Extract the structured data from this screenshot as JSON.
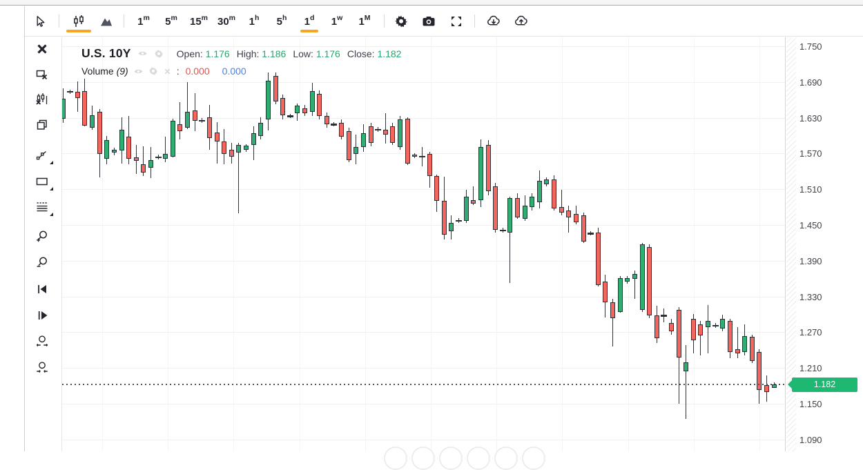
{
  "colors": {
    "accent_orange": "#f5a623",
    "up_green": "#2fae73",
    "down_red": "#f4655d",
    "wick_dark": "#2b2f36",
    "value_green": "#28a56e",
    "volume_red": "#df544e",
    "volume_blue": "#4a80e8",
    "badge_green": "#1fb873"
  },
  "toolbar": {
    "chart_tools": [
      {
        "icon": "cursor-icon",
        "selected": false
      },
      {
        "icon": "candlestick-icon",
        "selected": true
      },
      {
        "icon": "area-chart-icon",
        "selected": false
      }
    ],
    "intervals": [
      {
        "base": "1",
        "sup": "m",
        "selected": false
      },
      {
        "base": "5",
        "sup": "m",
        "selected": false
      },
      {
        "base": "15",
        "sup": "m",
        "selected": false
      },
      {
        "base": "30",
        "sup": "m",
        "selected": false
      },
      {
        "base": "1",
        "sup": "h",
        "selected": false
      },
      {
        "base": "5",
        "sup": "h",
        "selected": false
      },
      {
        "base": "1",
        "sup": "d",
        "selected": true
      },
      {
        "base": "1",
        "sup": "w",
        "selected": false
      },
      {
        "base": "1",
        "sup": "M",
        "selected": false
      }
    ],
    "actions": [
      {
        "icon": "settings-icon"
      },
      {
        "icon": "camera-icon"
      },
      {
        "icon": "fullscreen-icon"
      }
    ],
    "transfer": [
      {
        "icon": "download-icon"
      },
      {
        "icon": "upload-icon"
      }
    ]
  },
  "sidebar": {
    "tools": [
      {
        "icon": "close-icon",
        "dropdown": false
      },
      {
        "icon": "deselect-icon",
        "dropdown": false
      },
      {
        "icon": "remove-indicators-icon",
        "dropdown": false
      },
      {
        "icon": "clone-icon",
        "dropdown": false
      },
      {
        "icon": "trendline-icon",
        "dropdown": true
      },
      {
        "icon": "rectangle-icon",
        "dropdown": true
      },
      {
        "icon": "fib-lines-icon",
        "dropdown": true
      },
      {
        "icon": "zoom-in-icon",
        "dropdown": false
      },
      {
        "icon": "zoom-out-icon",
        "dropdown": false
      },
      {
        "icon": "scroll-left-icon",
        "dropdown": false
      },
      {
        "icon": "scroll-right-icon",
        "dropdown": false
      },
      {
        "icon": "zoom-range-icon",
        "dropdown": false
      },
      {
        "icon": "reset-zoom-icon",
        "dropdown": false
      }
    ]
  },
  "legend": {
    "symbol": "U.S. 10Y",
    "icons": [
      "eye-icon",
      "gear-sm-icon"
    ],
    "items": [
      {
        "label": "Open:",
        "value": "1.176"
      },
      {
        "label": "High:",
        "value": "1.186"
      },
      {
        "label": "Low:",
        "value": "1.176"
      },
      {
        "label": "Close:",
        "value": "1.182"
      }
    ]
  },
  "volume_row": {
    "label": "Volume",
    "param": "(9)",
    "icons": [
      "eye-icon",
      "gear-sm-icon",
      "x-sm-icon"
    ],
    "separator": ":",
    "values": [
      {
        "value": "0.000",
        "color": "volume_red"
      },
      {
        "value": "0.000",
        "color": "volume_blue"
      }
    ]
  },
  "y_axis": {
    "labels": [
      "1.750",
      "1.690",
      "1.630",
      "1.570",
      "1.510",
      "1.450",
      "1.390",
      "1.330",
      "1.270",
      "1.210",
      "1.150",
      "1.090"
    ]
  },
  "price_badge": {
    "value": "1.182"
  },
  "pager": {
    "dots": 6
  },
  "chart_data": {
    "type": "candlestick",
    "title": "U.S. 10Y",
    "interval": "1d",
    "ylim": [
      1.07,
      1.765
    ],
    "y_ticks": [
      1.75,
      1.69,
      1.63,
      1.57,
      1.51,
      1.45,
      1.39,
      1.33,
      1.27,
      1.21,
      1.15,
      1.09
    ],
    "current_price": 1.182,
    "grid": true,
    "legend_position": "top-left",
    "ohlc_format": [
      "open",
      "high",
      "low",
      "close",
      "kind(g=up,r=down,d=doji)"
    ],
    "candles": [
      [
        1.628,
        1.679,
        1.621,
        1.662,
        "g"
      ],
      [
        1.674,
        1.677,
        1.67,
        1.674,
        "d"
      ],
      [
        1.674,
        1.691,
        1.64,
        1.663,
        "r"
      ],
      [
        1.675,
        1.695,
        1.615,
        1.617,
        "r"
      ],
      [
        1.613,
        1.65,
        1.61,
        1.634,
        "g"
      ],
      [
        1.64,
        1.645,
        1.53,
        1.569,
        "r"
      ],
      [
        1.561,
        1.599,
        1.552,
        1.592,
        "g"
      ],
      [
        1.571,
        1.58,
        1.567,
        1.576,
        "g"
      ],
      [
        1.575,
        1.631,
        1.553,
        1.61,
        "g"
      ],
      [
        1.598,
        1.633,
        1.552,
        1.561,
        "r"
      ],
      [
        1.564,
        1.584,
        1.536,
        1.558,
        "r"
      ],
      [
        1.552,
        1.582,
        1.532,
        1.538,
        "r"
      ],
      [
        1.546,
        1.581,
        1.529,
        1.559,
        "g"
      ],
      [
        1.564,
        1.568,
        1.56,
        1.564,
        "d"
      ],
      [
        1.561,
        1.598,
        1.555,
        1.569,
        "g"
      ],
      [
        1.565,
        1.628,
        1.563,
        1.625,
        "g"
      ],
      [
        1.619,
        1.656,
        1.594,
        1.608,
        "r"
      ],
      [
        1.613,
        1.69,
        1.611,
        1.64,
        "g"
      ],
      [
        1.642,
        1.671,
        1.608,
        1.625,
        "r"
      ],
      [
        1.625,
        1.629,
        1.621,
        1.625,
        "d"
      ],
      [
        1.631,
        1.652,
        1.576,
        1.596,
        "r"
      ],
      [
        1.605,
        1.623,
        1.553,
        1.59,
        "r"
      ],
      [
        1.59,
        1.611,
        1.552,
        1.569,
        "r"
      ],
      [
        1.576,
        1.588,
        1.553,
        1.565,
        "r"
      ],
      [
        1.571,
        1.588,
        1.469,
        1.584,
        "g"
      ],
      [
        1.576,
        1.586,
        1.573,
        1.583,
        "g"
      ],
      [
        1.584,
        1.616,
        1.559,
        1.604,
        "g"
      ],
      [
        1.599,
        1.631,
        1.593,
        1.621,
        "g"
      ],
      [
        1.627,
        1.706,
        1.608,
        1.692,
        "g"
      ],
      [
        1.7,
        1.706,
        1.652,
        1.657,
        "r"
      ],
      [
        1.663,
        1.669,
        1.627,
        1.634,
        "r"
      ],
      [
        1.633,
        1.637,
        1.629,
        1.633,
        "d"
      ],
      [
        1.637,
        1.654,
        1.625,
        1.65,
        "g"
      ],
      [
        1.646,
        1.652,
        1.633,
        1.638,
        "r"
      ],
      [
        1.64,
        1.689,
        1.633,
        1.675,
        "g"
      ],
      [
        1.67,
        1.676,
        1.627,
        1.633,
        "r"
      ],
      [
        1.633,
        1.639,
        1.613,
        1.619,
        "r"
      ],
      [
        1.619,
        1.623,
        1.615,
        1.619,
        "d"
      ],
      [
        1.621,
        1.627,
        1.593,
        1.598,
        "r"
      ],
      [
        1.608,
        1.613,
        1.555,
        1.559,
        "r"
      ],
      [
        1.569,
        1.602,
        1.552,
        1.581,
        "g"
      ],
      [
        1.581,
        1.619,
        1.573,
        1.604,
        "g"
      ],
      [
        1.616,
        1.622,
        1.582,
        1.588,
        "r"
      ],
      [
        1.61,
        1.614,
        1.606,
        1.61,
        "d"
      ],
      [
        1.61,
        1.638,
        1.587,
        1.602,
        "r"
      ],
      [
        1.616,
        1.622,
        1.584,
        1.588,
        "r"
      ],
      [
        1.581,
        1.633,
        1.576,
        1.627,
        "g"
      ],
      [
        1.628,
        1.631,
        1.551,
        1.553,
        "r"
      ],
      [
        1.565,
        1.571,
        1.562,
        1.568,
        "g"
      ],
      [
        1.565,
        1.581,
        1.548,
        1.565,
        "d"
      ],
      [
        1.569,
        1.573,
        1.513,
        1.532,
        "r"
      ],
      [
        1.532,
        1.534,
        1.472,
        1.49,
        "r"
      ],
      [
        1.49,
        1.531,
        1.426,
        1.434,
        "r"
      ],
      [
        1.44,
        1.466,
        1.425,
        1.454,
        "g"
      ],
      [
        1.457,
        1.461,
        1.453,
        1.457,
        "d"
      ],
      [
        1.457,
        1.509,
        1.454,
        1.498,
        "g"
      ],
      [
        1.492,
        1.515,
        1.483,
        1.486,
        "r"
      ],
      [
        1.492,
        1.594,
        1.48,
        1.581,
        "g"
      ],
      [
        1.584,
        1.593,
        1.5,
        1.507,
        "r"
      ],
      [
        1.515,
        1.521,
        1.437,
        1.442,
        "r"
      ],
      [
        1.441,
        1.445,
        1.437,
        1.441,
        "d"
      ],
      [
        1.437,
        1.498,
        1.353,
        1.495,
        "g"
      ],
      [
        1.495,
        1.503,
        1.46,
        1.463,
        "r"
      ],
      [
        1.461,
        1.5,
        1.457,
        1.483,
        "g"
      ],
      [
        1.48,
        1.503,
        1.474,
        1.498,
        "g"
      ],
      [
        1.488,
        1.542,
        1.478,
        1.524,
        "g"
      ],
      [
        1.518,
        1.53,
        1.515,
        1.527,
        "g"
      ],
      [
        1.527,
        1.533,
        1.474,
        1.478,
        "r"
      ],
      [
        1.48,
        1.509,
        1.466,
        1.471,
        "r"
      ],
      [
        1.474,
        1.483,
        1.437,
        1.463,
        "r"
      ],
      [
        1.469,
        1.483,
        1.451,
        1.455,
        "r"
      ],
      [
        1.466,
        1.471,
        1.42,
        1.422,
        "r"
      ],
      [
        1.436,
        1.44,
        1.432,
        1.436,
        "d"
      ],
      [
        1.437,
        1.445,
        1.347,
        1.349,
        "r"
      ],
      [
        1.355,
        1.367,
        1.295,
        1.32,
        "r"
      ],
      [
        1.32,
        1.326,
        1.246,
        1.293,
        "r"
      ],
      [
        1.304,
        1.364,
        1.303,
        1.361,
        "g"
      ],
      [
        1.355,
        1.364,
        1.352,
        1.361,
        "g"
      ],
      [
        1.359,
        1.374,
        1.326,
        1.368,
        "g"
      ],
      [
        1.307,
        1.42,
        1.304,
        1.417,
        "g"
      ],
      [
        1.413,
        1.417,
        1.293,
        1.298,
        "r"
      ],
      [
        1.298,
        1.315,
        1.252,
        1.26,
        "r"
      ],
      [
        1.298,
        1.31,
        1.287,
        1.298,
        "d"
      ],
      [
        1.285,
        1.293,
        1.266,
        1.272,
        "r"
      ],
      [
        1.307,
        1.312,
        1.15,
        1.228,
        "r"
      ],
      [
        1.204,
        1.249,
        1.125,
        1.22,
        "g"
      ],
      [
        1.293,
        1.301,
        1.234,
        1.257,
        "r"
      ],
      [
        1.283,
        1.289,
        1.231,
        1.264,
        "r"
      ],
      [
        1.278,
        1.316,
        1.234,
        1.289,
        "g"
      ],
      [
        1.281,
        1.285,
        1.277,
        1.281,
        "d"
      ],
      [
        1.276,
        1.299,
        1.272,
        1.293,
        "g"
      ],
      [
        1.289,
        1.293,
        1.226,
        1.237,
        "r"
      ],
      [
        1.241,
        1.278,
        1.226,
        1.234,
        "r"
      ],
      [
        1.237,
        1.283,
        1.231,
        1.264,
        "g"
      ],
      [
        1.262,
        1.266,
        1.218,
        1.222,
        "r"
      ],
      [
        1.237,
        1.241,
        1.15,
        1.173,
        "r"
      ],
      [
        1.181,
        1.198,
        1.153,
        1.17,
        "r"
      ],
      [
        1.176,
        1.186,
        1.176,
        1.182,
        "g"
      ]
    ]
  }
}
